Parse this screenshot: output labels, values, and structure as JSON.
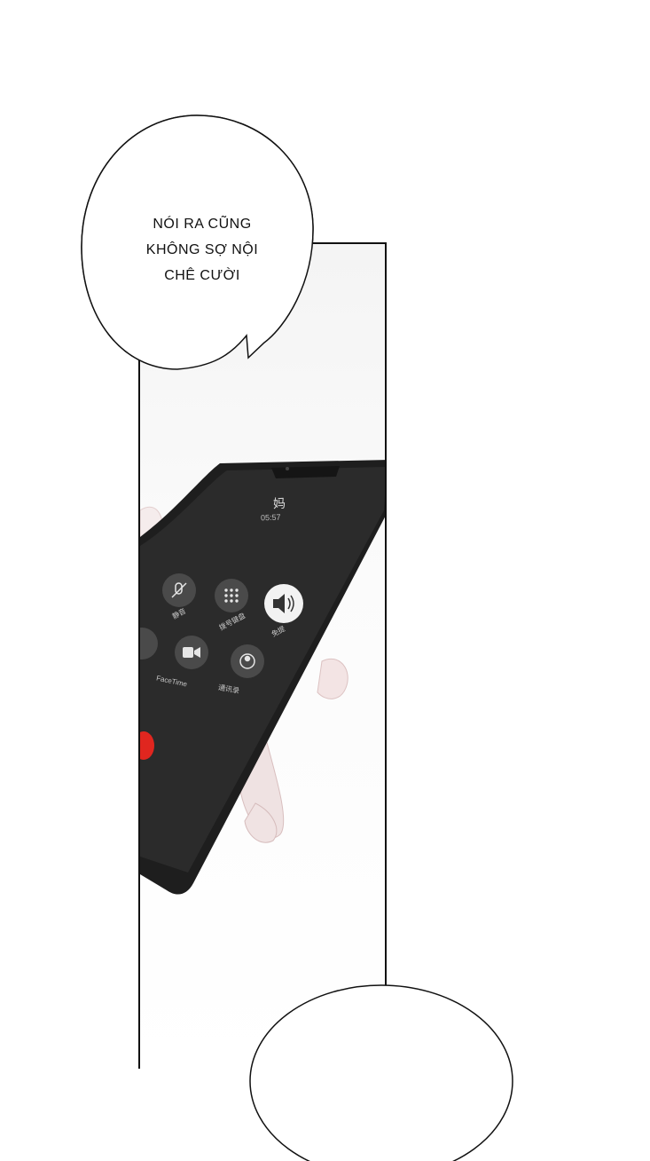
{
  "speech_bubble": {
    "line1": "NÓI RA CŨNG",
    "line2": "KHÔNG SỢ NỘI",
    "line3": "CHÊ CƯỜI"
  },
  "phone": {
    "caller": "妈",
    "timer": "05:57",
    "buttons": [
      {
        "label": "静音",
        "icon": "mute-icon"
      },
      {
        "label": "拨号键盘",
        "icon": "keypad-icon"
      },
      {
        "label": "免提",
        "icon": "speaker-icon"
      },
      {
        "label": "FaceTime",
        "icon": "facetime-icon"
      },
      {
        "label": "通讯录",
        "icon": "contacts-icon"
      }
    ],
    "colors": {
      "body": "#1e1e1e",
      "screen": "#2b2b2b",
      "end_call": "#e0261f",
      "speaker_active": "#f2f2f2"
    }
  }
}
